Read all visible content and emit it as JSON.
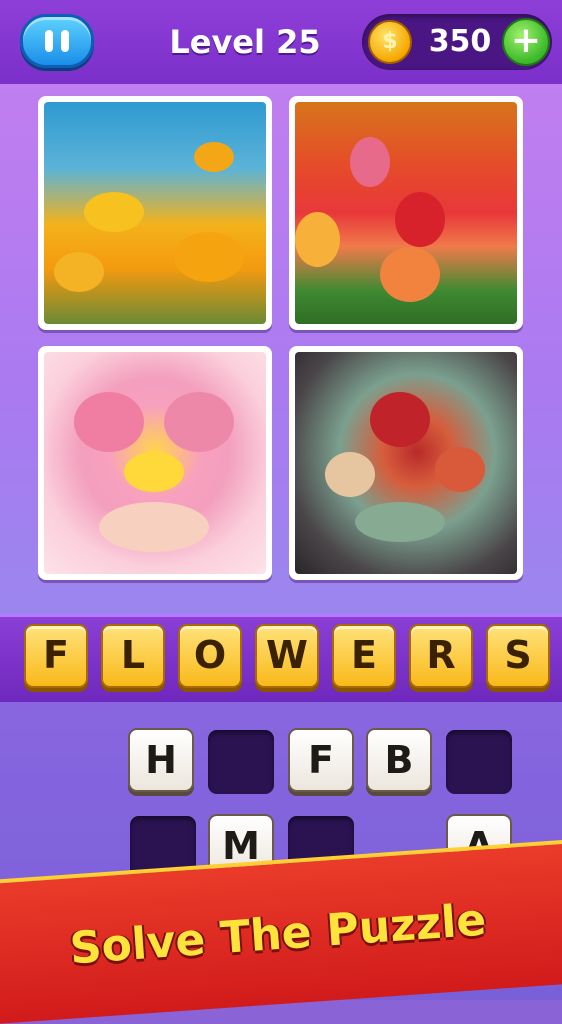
{
  "header": {
    "level_label": "Level 25",
    "coins": "350",
    "coin_symbol": "$",
    "plus_symbol": "+"
  },
  "photos": [
    {
      "subject": "yellow poppies"
    },
    {
      "subject": "tulips"
    },
    {
      "subject": "heart of flowers"
    },
    {
      "subject": "bouquet of roses"
    }
  ],
  "answer": {
    "letters": [
      "F",
      "L",
      "O",
      "W",
      "E",
      "R",
      "S"
    ]
  },
  "pool": {
    "row1": [
      "H",
      "",
      "F",
      "B",
      ""
    ],
    "row2": [
      "",
      "M",
      "",
      "",
      "A"
    ]
  },
  "banner": {
    "text": "Solve The Puzzle"
  },
  "colors": {
    "header": "#7b2fc9",
    "answer_tile": "#f9b91a",
    "banner": "#d11b1b",
    "banner_text": "#ffe23b"
  }
}
